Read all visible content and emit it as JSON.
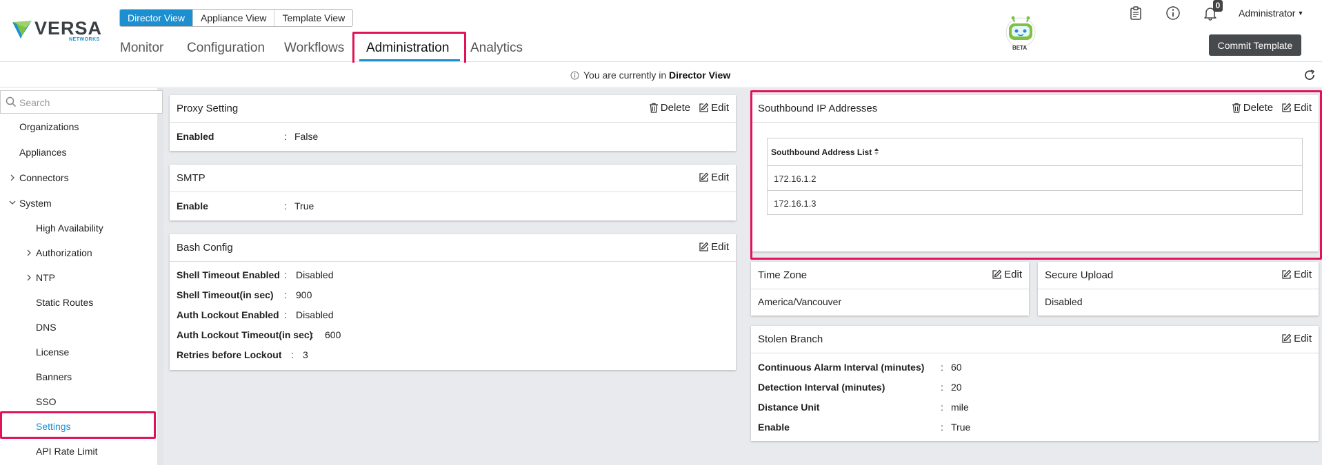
{
  "header": {
    "logo": {
      "name": "VERSA",
      "sub": "NETWORKS"
    },
    "view_switch": [
      "Director View",
      "Appliance View",
      "Template View"
    ],
    "active_view": "Director View",
    "nav": [
      "Monitor",
      "Configuration",
      "Workflows",
      "Administration",
      "Analytics"
    ],
    "active_nav": "Administration",
    "robot_badge": "BETA",
    "notification_count": "0",
    "user": "Administrator",
    "commit_label": "Commit Template"
  },
  "infobar": {
    "prefix": "You are currently in",
    "view": "Director View"
  },
  "sidebar": {
    "search_placeholder": "Search",
    "items": [
      "Organizations",
      "Appliances",
      "Connectors",
      "System"
    ],
    "system_children": [
      "High Availability",
      "Authorization",
      "NTP",
      "Static Routes",
      "DNS",
      "License",
      "Banners",
      "SSO",
      "Settings",
      "API Rate Limit"
    ],
    "active": "Settings"
  },
  "actions": {
    "delete": "Delete",
    "edit": "Edit"
  },
  "cards": {
    "proxy": {
      "title": "Proxy Setting",
      "rows": [
        {
          "label": "Enabled",
          "value": "False"
        }
      ]
    },
    "smtp": {
      "title": "SMTP",
      "rows": [
        {
          "label": "Enable",
          "value": "True"
        }
      ]
    },
    "bash": {
      "title": "Bash Config",
      "rows": [
        {
          "label": "Shell Timeout Enabled",
          "value": "Disabled"
        },
        {
          "label": "Shell Timeout(in sec)",
          "value": "900"
        },
        {
          "label": "Auth Lockout Enabled",
          "value": "Disabled"
        },
        {
          "label": "Auth Lockout Timeout(in sec)",
          "value": "600"
        },
        {
          "label": "Retries before Lockout",
          "value": "3"
        }
      ]
    },
    "southbound": {
      "title": "Southbound IP Addresses",
      "column": "Southbound Address List",
      "addresses": [
        "172.16.1.2",
        "172.16.1.3"
      ]
    },
    "timezone": {
      "title": "Time Zone",
      "value": "America/Vancouver"
    },
    "secure_upload": {
      "title": "Secure Upload",
      "value": "Disabled"
    },
    "stolen": {
      "title": "Stolen Branch",
      "rows": [
        {
          "label": "Continuous Alarm Interval (minutes)",
          "value": "60"
        },
        {
          "label": "Detection Interval (minutes)",
          "value": "20"
        },
        {
          "label": "Distance Unit",
          "value": "mile"
        },
        {
          "label": "Enable",
          "value": "True"
        }
      ]
    }
  },
  "colors": {
    "accent": "#1b8fd0",
    "highlight": "#e0125a",
    "button": "#474a4d",
    "content_bg": "#e8eaed"
  }
}
